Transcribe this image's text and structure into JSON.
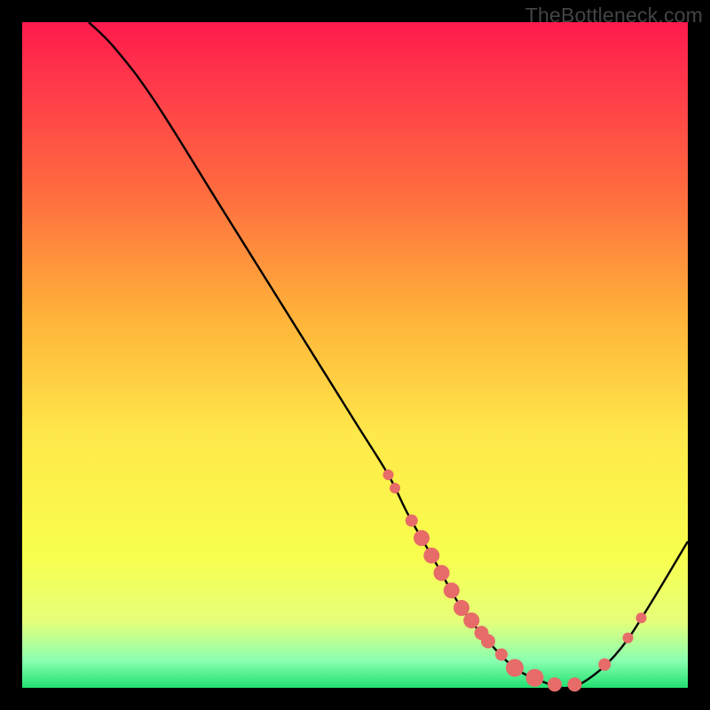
{
  "watermark": {
    "text": "TheBottleneck.com"
  },
  "chart_data": {
    "type": "line",
    "title": "",
    "xlabel": "",
    "ylabel": "",
    "xlim": [
      0,
      100
    ],
    "ylim": [
      0,
      100
    ],
    "series": [
      {
        "name": "curve",
        "x": [
          10,
          14,
          20,
          30,
          40,
          50,
          55,
          58,
          62,
          66,
          70,
          74,
          78,
          82,
          86,
          90,
          94,
          100
        ],
        "y": [
          100,
          96,
          88,
          72,
          56,
          40,
          32,
          26,
          19,
          12,
          7,
          3,
          1,
          0,
          2,
          6,
          12,
          22
        ]
      }
    ],
    "markers": {
      "name": "scatter-points",
      "points": [
        {
          "x": 55.0,
          "r": 6
        },
        {
          "x": 56.0,
          "r": 6
        },
        {
          "x": 58.5,
          "r": 7
        },
        {
          "x": 60.0,
          "r": 9
        },
        {
          "x": 61.5,
          "r": 9
        },
        {
          "x": 63.0,
          "r": 9
        },
        {
          "x": 64.5,
          "r": 9
        },
        {
          "x": 66.0,
          "r": 9
        },
        {
          "x": 67.5,
          "r": 9
        },
        {
          "x": 69.0,
          "r": 8
        },
        {
          "x": 70.0,
          "r": 8
        },
        {
          "x": 72.0,
          "r": 7
        },
        {
          "x": 74.0,
          "r": 10
        },
        {
          "x": 77.0,
          "r": 10
        },
        {
          "x": 80.0,
          "r": 8
        },
        {
          "x": 83.0,
          "r": 8
        },
        {
          "x": 87.5,
          "r": 7
        },
        {
          "x": 91.0,
          "r": 6
        },
        {
          "x": 93.0,
          "r": 6
        }
      ],
      "color": "#e76b68"
    }
  }
}
